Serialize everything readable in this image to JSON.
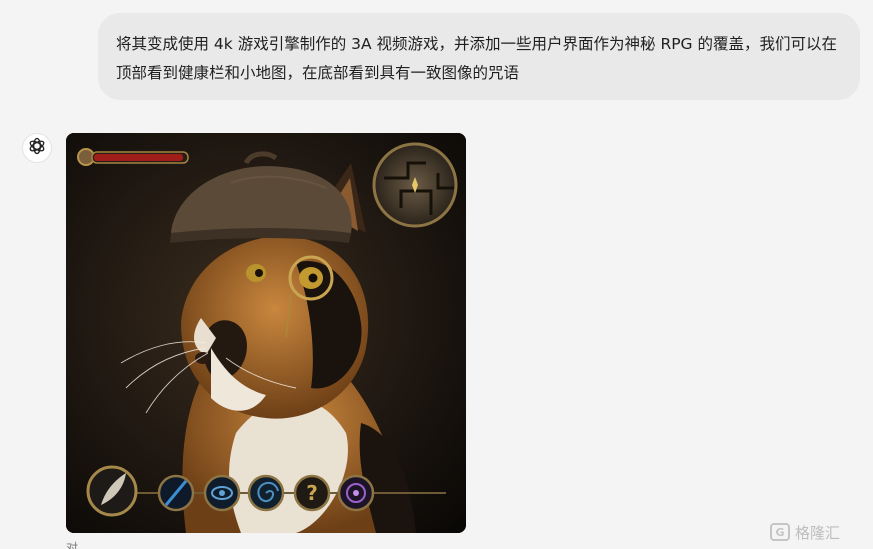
{
  "conversation": {
    "user_message": "将其变成使用 4k 游戏引擎制作的 3A 视频游戏，并添加一些用户界面作为神秘 RPG 的覆盖，我们可以在顶部看到健康栏和小地图，在底部看到具有一致图像的咒语",
    "assistant": {
      "avatar_icon": "openai-logo-icon",
      "image": {
        "subject": "calico-cat-detective",
        "hud": {
          "health_fraction": 0.95,
          "minimap_icon": "minimap-icon",
          "spell_icons": [
            "feather-icon",
            "blue-slash-icon",
            "eye-icon",
            "swirl-icon",
            "question-icon",
            "purple-vortex-icon"
          ]
        }
      }
    },
    "following_text_fragment": "对"
  },
  "watermark": {
    "text": "格隆汇",
    "icon_text": "G"
  }
}
